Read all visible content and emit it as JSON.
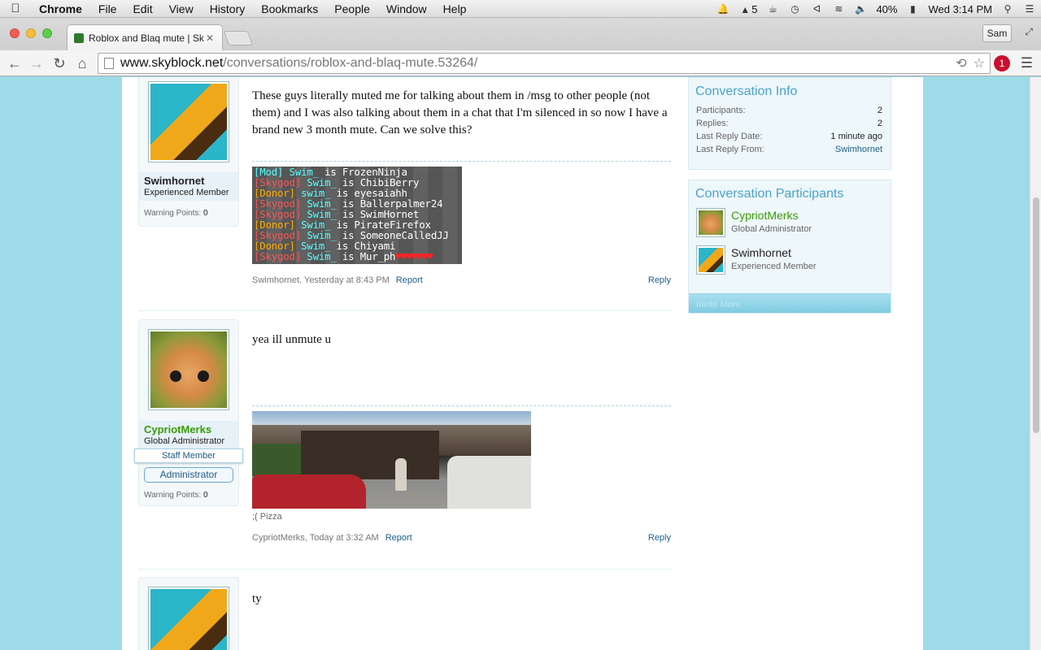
{
  "menubar": {
    "app": "Chrome",
    "items": [
      "File",
      "Edit",
      "View",
      "History",
      "Bookmarks",
      "People",
      "Window",
      "Help"
    ],
    "adobe_count": "5",
    "battery": "40%",
    "clock": "Wed 3:14 PM"
  },
  "browser": {
    "tab_title": "Roblox and Blaq mute | Sk",
    "profile": "Sam",
    "url_host": "www.skyblock.net",
    "url_path": "/conversations/roblox-and-blaq-mute.53264/",
    "ext_badge": "1"
  },
  "messages": [
    {
      "username": "Swimhornet",
      "title": "Experienced Member",
      "warning_label": "Warning Points:",
      "warning_value": "0",
      "text": "These guys literally muted me for talking about them in /msg to other people (not them) and I was also talking about them in a chat that I'm silenced in so now I have a brand new 3 month mute. Can we solve this?",
      "meta": "Swimhornet, Yesterday at 8:43 PM",
      "report": "Report",
      "reply": "Reply"
    },
    {
      "username": "CypriotMerks",
      "title": "Global Administrator",
      "staff": "Staff Member",
      "banner": "Administrator",
      "warning_label": "Warning Points:",
      "warning_value": "0",
      "text": "yea ill unmute u",
      "signature": ";( Pizza",
      "meta": "CypriotMerks, Today at 3:32 AM",
      "report": "Report",
      "reply": "Reply"
    },
    {
      "text": "ty"
    }
  ],
  "minecraft_lines": [
    {
      "rank": "[Mod]",
      "name": "Swim_",
      "rest": " is FrozenNinja"
    },
    {
      "rank": "[Skygod]",
      "name": "Swim_",
      "rest": " is ChibiBerry"
    },
    {
      "rank": "[Donor]",
      "name": "swim_",
      "rest": " is eyesaiahh"
    },
    {
      "rank": "[Skygod]",
      "name": "Swim_",
      "rest": " is Ballerpalmer24"
    },
    {
      "rank": "[Skygod]",
      "name": "Swim_",
      "rest": " is SwimHornet"
    },
    {
      "rank": "[Donor]",
      "name": "Swim_",
      "rest": " is PirateFirefox"
    },
    {
      "rank": "[Skygod]",
      "name": "Swim_",
      "rest": " is SomeoneCalledJJ"
    },
    {
      "rank": "[Donor]",
      "name": "Swim_",
      "rest": " is Chiyami"
    },
    {
      "rank": "[Skygod]",
      "name": "Swim_",
      "rest": " is Mur_ph"
    }
  ],
  "sidebar": {
    "info_title": "Conversation Info",
    "info": [
      {
        "label": "Participants:",
        "value": "2"
      },
      {
        "label": "Replies:",
        "value": "2"
      },
      {
        "label": "Last Reply Date:",
        "value": "1 minute ago"
      },
      {
        "label": "Last Reply From:",
        "value": "Swimhornet"
      }
    ],
    "participants_title": "Conversation Participants",
    "participants": [
      {
        "name": "CypriotMerks",
        "title": "Global Administrator"
      },
      {
        "name": "Swimhornet",
        "title": "Experienced Member"
      }
    ],
    "invite": "Invite More"
  }
}
